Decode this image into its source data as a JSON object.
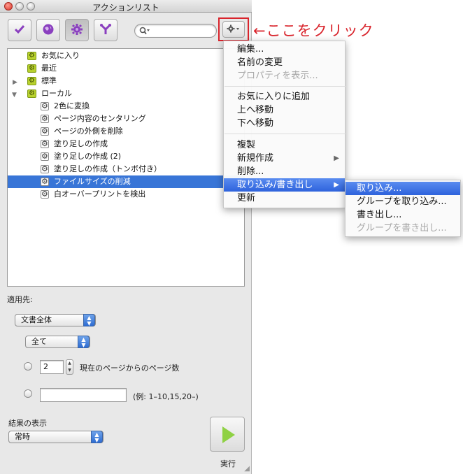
{
  "window": {
    "title": "アクションリスト"
  },
  "search": {
    "placeholder": ""
  },
  "annotation": {
    "text": "←ここをクリック"
  },
  "tree": {
    "items": [
      {
        "label": "お気に入り",
        "kind": "folder",
        "selected": false
      },
      {
        "label": "最近",
        "kind": "folder",
        "selected": false
      },
      {
        "label": "標準",
        "kind": "folder",
        "selected": false,
        "expandable": true
      },
      {
        "label": "ローカル",
        "kind": "folder",
        "selected": false,
        "expanded": true
      },
      {
        "label": "2色に変換",
        "kind": "action",
        "selected": false
      },
      {
        "label": "ページ内容のセンタリング",
        "kind": "action",
        "selected": false
      },
      {
        "label": "ページの外側を削除",
        "kind": "action",
        "selected": false
      },
      {
        "label": "塗り足しの作成",
        "kind": "action",
        "selected": false
      },
      {
        "label": "塗り足しの作成 (2)",
        "kind": "action",
        "selected": false
      },
      {
        "label": "塗り足しの作成（トンボ付き）",
        "kind": "action",
        "selected": false
      },
      {
        "label": "ファイルサイズの削減",
        "kind": "action",
        "selected": true
      },
      {
        "label": "白オーバープリントを検出",
        "kind": "action",
        "selected": false
      }
    ]
  },
  "apply": {
    "heading": "適用先:",
    "scope_select": "文書全体",
    "pages_select": "全て",
    "page_count_value": "2",
    "page_count_label": "現在のページからのページ数",
    "range_value": "",
    "range_hint": "(例: 1–10,15,20–)"
  },
  "results": {
    "heading": "結果の表示",
    "select": "常時"
  },
  "run": {
    "label": "実行"
  },
  "menu": {
    "items": [
      {
        "label": "編集...",
        "disabled": false
      },
      {
        "label": "名前の変更",
        "disabled": false
      },
      {
        "label": "プロパティを表示...",
        "disabled": true
      },
      {
        "label": "お気に入りに追加",
        "disabled": false
      },
      {
        "label": "上へ移動",
        "disabled": false
      },
      {
        "label": "下へ移動",
        "disabled": false
      },
      {
        "label": "複製",
        "disabled": false
      },
      {
        "label": "新規作成",
        "disabled": false,
        "submenu": true
      },
      {
        "label": "削除...",
        "disabled": false
      },
      {
        "label": "取り込み/書き出し",
        "disabled": false,
        "submenu": true,
        "active": true
      },
      {
        "label": "更新",
        "disabled": false
      }
    ]
  },
  "submenu": {
    "items": [
      {
        "label": "取り込み...",
        "disabled": false,
        "active": true
      },
      {
        "label": "グループを取り込み...",
        "disabled": false
      },
      {
        "label": "書き出し...",
        "disabled": false
      },
      {
        "label": "グループを書き出し...",
        "disabled": true
      }
    ]
  },
  "colors": {
    "selection": "#3875d7",
    "menu_highlight": "#2e63dc",
    "annotation": "#d9242c",
    "folder": "#b9d22e"
  }
}
